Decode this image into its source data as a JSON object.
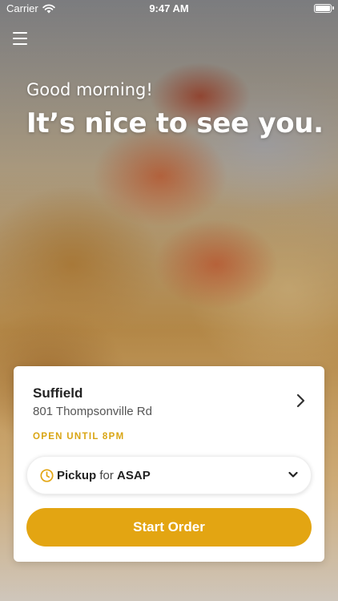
{
  "status_bar": {
    "carrier": "Carrier",
    "time": "9:47 AM"
  },
  "hero": {
    "greeting": "Good morning!",
    "headline": "It’s nice to see you."
  },
  "location": {
    "name": "Suffield",
    "address": "801 Thompsonville Rd",
    "hours": "OPEN UNTIL 8PM"
  },
  "order_type": {
    "method": "Pickup",
    "connector": "for",
    "time": "ASAP"
  },
  "actions": {
    "start_order": "Start Order"
  },
  "colors": {
    "accent": "#e3a512",
    "hours_text": "#d9a514"
  },
  "icons": {
    "menu": "menu-icon",
    "wifi": "wifi-icon",
    "battery": "battery-icon",
    "chevron_right": "chevron-right-icon",
    "clock": "clock-icon",
    "chevron_down": "chevron-down-icon"
  }
}
